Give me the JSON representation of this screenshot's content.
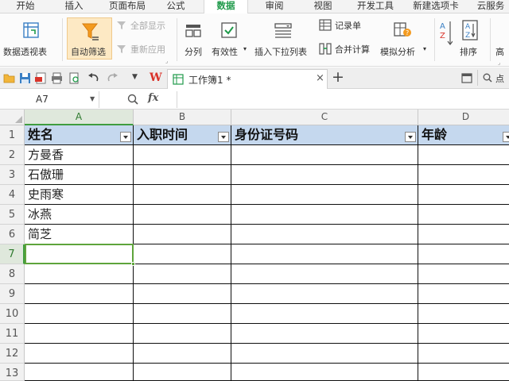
{
  "menu_tabs": [
    {
      "label": "开始"
    },
    {
      "label": "插入"
    },
    {
      "label": "页面布局"
    },
    {
      "label": "公式"
    },
    {
      "label": "数据",
      "active": true
    },
    {
      "label": "审阅"
    },
    {
      "label": "视图"
    },
    {
      "label": "开发工具"
    },
    {
      "label": "新建选项卡"
    },
    {
      "label": "云服务"
    }
  ],
  "ribbon": {
    "pivot_table": "数据透视表",
    "auto_filter": "自动筛选",
    "show_all": "全部显示",
    "reapply": "重新应用",
    "split_columns": "分列",
    "validation": "有效性",
    "insert_dropdown": "插入下拉列表",
    "record_form": "记录单",
    "consolidate": "合并计算",
    "what_if": "模拟分析",
    "sort": "排序",
    "advanced": "高",
    "sort_az": "A↓Z"
  },
  "tab_bar": {
    "app_logo": "W",
    "doc_title": "工作簿1 *",
    "close_glyph": "×",
    "add_glyph": "+",
    "search_hint": "点"
  },
  "formula_bar": {
    "name_box": "A7",
    "fx_label": "fx",
    "formula": ""
  },
  "grid": {
    "columns": [
      "A",
      "B",
      "C",
      "D"
    ],
    "rows": [
      "1",
      "2",
      "3",
      "4",
      "5",
      "6",
      "7",
      "8",
      "9",
      "10",
      "11",
      "12",
      "13"
    ],
    "header_cells": [
      "姓名",
      "入职时间",
      "身份证号码",
      "年龄"
    ],
    "names": [
      "方曼香",
      "石傲珊",
      "史雨寒",
      "冰燕",
      "简芝"
    ],
    "active_cell": "A7"
  },
  "colors": {
    "accent_green": "#1f9a4a",
    "header_fill": "#c5d8ee",
    "selection_green": "#5ea43b",
    "filter_orange": "#f39a1e",
    "wps_red": "#d9332a"
  }
}
